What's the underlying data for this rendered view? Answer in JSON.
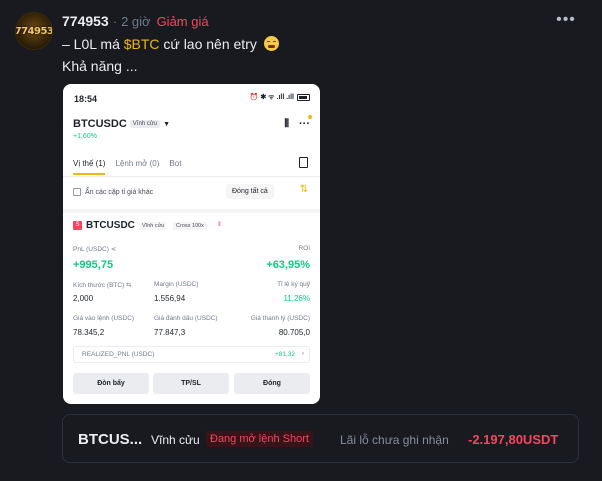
{
  "post": {
    "avatar_text": "774953",
    "username": "774953",
    "separator": "·",
    "time": "2 giờ",
    "sentiment": "Giảm giá",
    "more_icon": "more-horizontal-icon",
    "line1_prefix": "– L0L má ",
    "cashtag": "$BTC",
    "line1_suffix": " cứ lao nên etry",
    "emoji": "tired-face-emoji",
    "line2": "Khả năng ..."
  },
  "phone": {
    "status_time": "18:54",
    "status_icons": "⏰ ✱ ᯤ .ıll .ıll",
    "battery": "58",
    "pair": "BTCUSDC",
    "pair_badge": "Vĩnh cửu",
    "caret": "▼",
    "change": "+1,60%",
    "chart_icon": "candlestick-icon",
    "more_icon": "more-dots-icon",
    "tabs": [
      "Vị thế (1)",
      "Lệnh mở (0)",
      "Bot"
    ],
    "hide_label": "Ẩn các cặp tỉ giá khác",
    "close_all": "Đóng tất cả",
    "sort_icon": "⇅",
    "position": {
      "side_badge": "S",
      "symbol": "BTCUSDC",
      "tag_perp": "Vĩnh cửu",
      "tag_cross": "Cross 100x",
      "bars": "⦀",
      "pnl_label": "PnL (USDC)",
      "pnl_value": "+995,75",
      "roi_label": "ROI",
      "roi_value": "+63,95%",
      "size_label": "Kích thước (BTC)",
      "size_value": "2,000",
      "margin_label": "Margin (USDC)",
      "margin_value": "1.556,94",
      "ratio_label": "Tỉ lệ ký quỹ",
      "ratio_value": "11,26%",
      "entry_label": "Giá vào lệnh (USDC)",
      "entry_value": "78.345,2",
      "mark_label": "Giá đánh dấu (USDC)",
      "mark_value": "77.847,3",
      "liq_label": "Giá thanh lý (USDC)",
      "liq_value": "80.705,0",
      "realized_label": "REALIZED_PNL (USDC)",
      "realized_value": "+81,32",
      "chevron": "›"
    },
    "buttons": [
      "Đòn bẩy",
      "TP/SL",
      "Đóng"
    ]
  },
  "trade_card": {
    "symbol": "BTCUS...",
    "type": "Vĩnh cửu",
    "status": "Đang mở lệnh Short",
    "pnl_label": "Lãi lỗ chưa ghi nhận",
    "pnl_value": "-2.197,80USDT"
  },
  "colors": {
    "background": "#181a20",
    "accent": "#f0b90b",
    "positive": "#0ecb81",
    "negative": "#f6465d"
  }
}
